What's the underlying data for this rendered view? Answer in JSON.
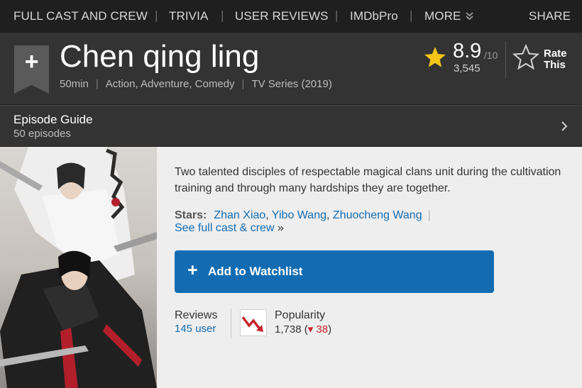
{
  "topnav": {
    "items": [
      "FULL CAST AND CREW",
      "TRIVIA",
      "USER REVIEWS",
      "IMDbPro",
      "MORE"
    ],
    "share": "SHARE"
  },
  "title": {
    "name": "Chen qing ling",
    "runtime": "50min",
    "genres": "Action, Adventure, Comedy",
    "type": "TV Series (2019)"
  },
  "rating": {
    "value": "8.9",
    "max": "/10",
    "count": "3,545",
    "rate_label": "Rate This"
  },
  "episodes": {
    "title": "Episode Guide",
    "count": "50 episodes"
  },
  "summary": "Two talented disciples of respectable magical clans unit during the cultivation training and through many hardships they are together.",
  "stars": {
    "label": "Stars:",
    "names": [
      "Zhan Xiao",
      "Yibo Wang",
      "Zhuocheng Wang"
    ],
    "separator": ",",
    "bar": "|",
    "full_cast": "See full cast & crew",
    "arrow": "»"
  },
  "watchlist": {
    "plus": "+",
    "label": "Add to Watchlist"
  },
  "reviews": {
    "label": "Reviews",
    "count": "145 user"
  },
  "popularity": {
    "label": "Popularity",
    "rank": "1,738",
    "open": "(",
    "change": "38",
    "close": ")"
  },
  "colors": {
    "accent": "#136cb2",
    "star": "#f5c518",
    "down": "#c8262c"
  }
}
